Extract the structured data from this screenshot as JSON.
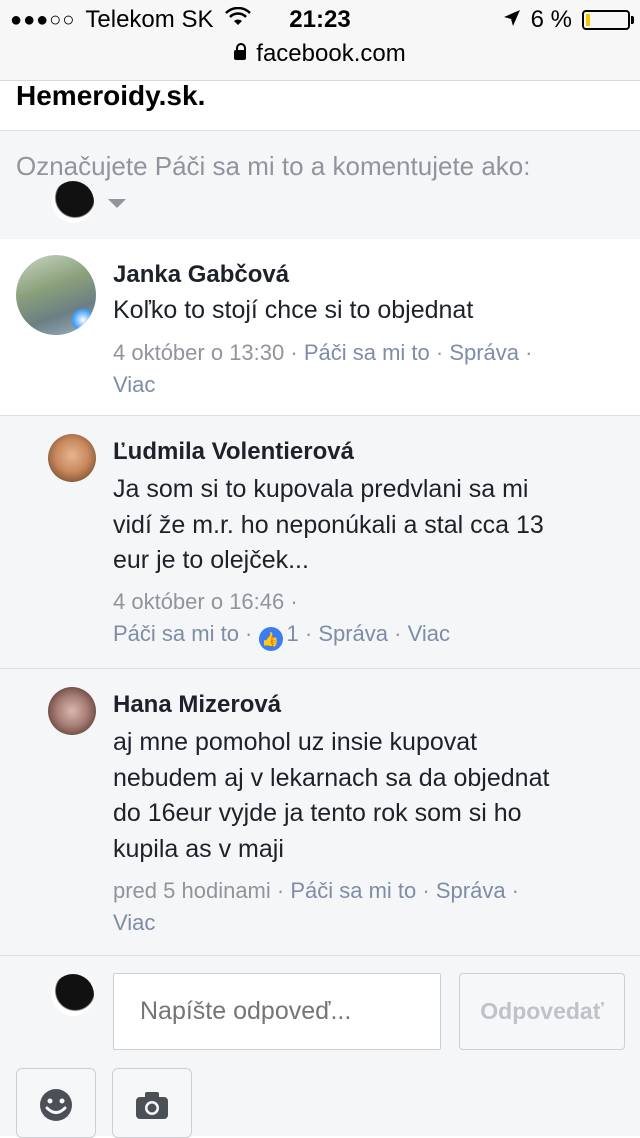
{
  "status_bar": {
    "signal": "●●●○○",
    "carrier": "Telekom SK",
    "time": "21:23",
    "battery": "6 %",
    "battery_level": 0.06,
    "url": "facebook.com"
  },
  "page": {
    "partial_title": "Hemeroidy.sk."
  },
  "acting_as": {
    "label": "Označujete Páči sa mi to a komentujete ako:"
  },
  "comments": [
    {
      "author": "Janka Gabčová",
      "text": "Koľko to stojí chce si to objednat",
      "time": "4 október o 13:30",
      "like": "Páči sa mi to",
      "reply": "Správa",
      "more": "Viac"
    },
    {
      "author": "Ľudmila Volentierová",
      "text_lines": [
        "Ja som si to kupovala predvlani sa mi",
        "vidí že m.r. ho neponúkali a stal cca 13",
        "eur je to olejček..."
      ],
      "time": "4 október o 16:46",
      "like": "Páči sa mi to",
      "reactions": "1",
      "reply": "Správa",
      "more": "Viac"
    },
    {
      "author": "Hana Mizerová",
      "text_lines": [
        "aj mne pomohol uz insie kupovat",
        "nebudem aj v lekarnach sa da objednat",
        "do 16eur vyjde ja tento rok som si ho",
        "kupila as v maji"
      ],
      "time": "pred 5 hodinami",
      "like": "Páči sa mi to",
      "reply": "Správa",
      "more": "Viac"
    }
  ],
  "reply_box": {
    "placeholder": "Napíšte odpoveď...",
    "submit": "Odpovedať"
  },
  "colors": {
    "link": "#7f8ca8",
    "meta": "#90949c",
    "reaction_blue": "#3b7df5"
  }
}
